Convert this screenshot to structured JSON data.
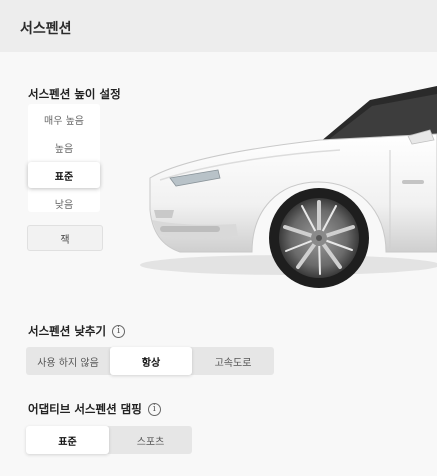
{
  "header": {
    "title": "서스펜션"
  },
  "height_section": {
    "title": "서스펜션 높이 설정",
    "options": [
      "매우 높음",
      "높음",
      "표준",
      "낮음"
    ],
    "selected": "표준",
    "jack_label": "잭"
  },
  "lowering_section": {
    "title": "서스펜션 낮추기",
    "info_icon": "info-icon",
    "options": [
      "사용 하지 않음",
      "항상",
      "고속도로"
    ],
    "selected": "항상"
  },
  "damping_section": {
    "title": "어댑티브 서스펜션 댐핑",
    "info_icon": "info-icon",
    "options": [
      "표준",
      "스포츠"
    ],
    "selected": "표준"
  },
  "colors": {
    "background": "#f8f8f8",
    "header": "#ededed",
    "segment_bg": "#e6e6e6",
    "selected_bg": "#ffffff"
  }
}
